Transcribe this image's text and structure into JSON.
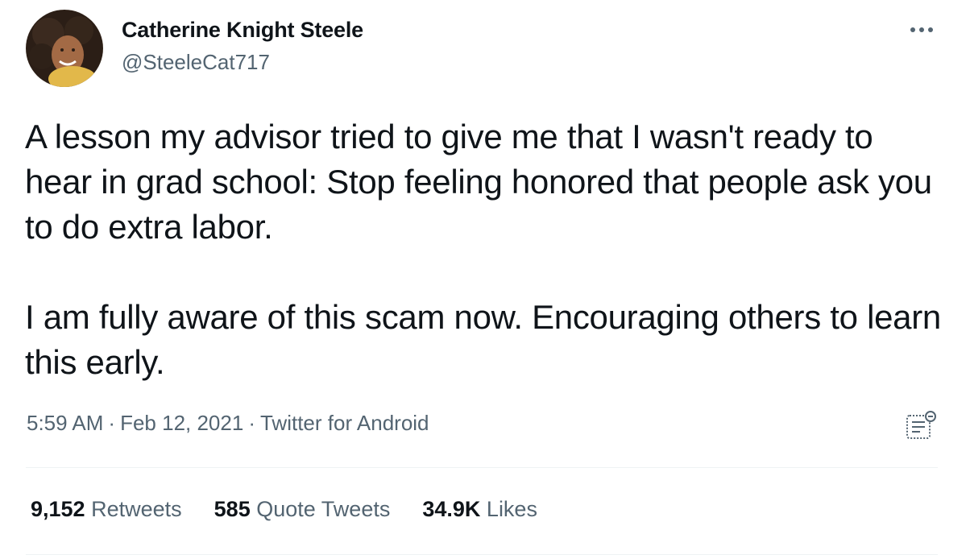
{
  "author": {
    "name": "Catherine Knight Steele",
    "handle": "@SteeleCat717"
  },
  "icons": {
    "more": "more-horizontal-icon",
    "analytics": "tweet-analytics-icon"
  },
  "tweet": {
    "paragraph_1": "A lesson my advisor tried to give me that I wasn't ready to hear in grad school: Stop feeling honored that people ask you to do extra labor.",
    "paragraph_2": "I am fully aware of this scam now. Encouraging others to learn this early."
  },
  "meta": {
    "time": "5:59 AM",
    "separator": "·",
    "date": "Feb 12, 2021",
    "source": "Twitter for Android"
  },
  "stats": {
    "retweets_count": "9,152",
    "retweets_label": "Retweets",
    "quotes_count": "585",
    "quotes_label": "Quote Tweets",
    "likes_count": "34.9K",
    "likes_label": "Likes"
  },
  "colors": {
    "text_primary": "#0f1419",
    "text_secondary": "#536471",
    "divider": "#eff3f4"
  }
}
